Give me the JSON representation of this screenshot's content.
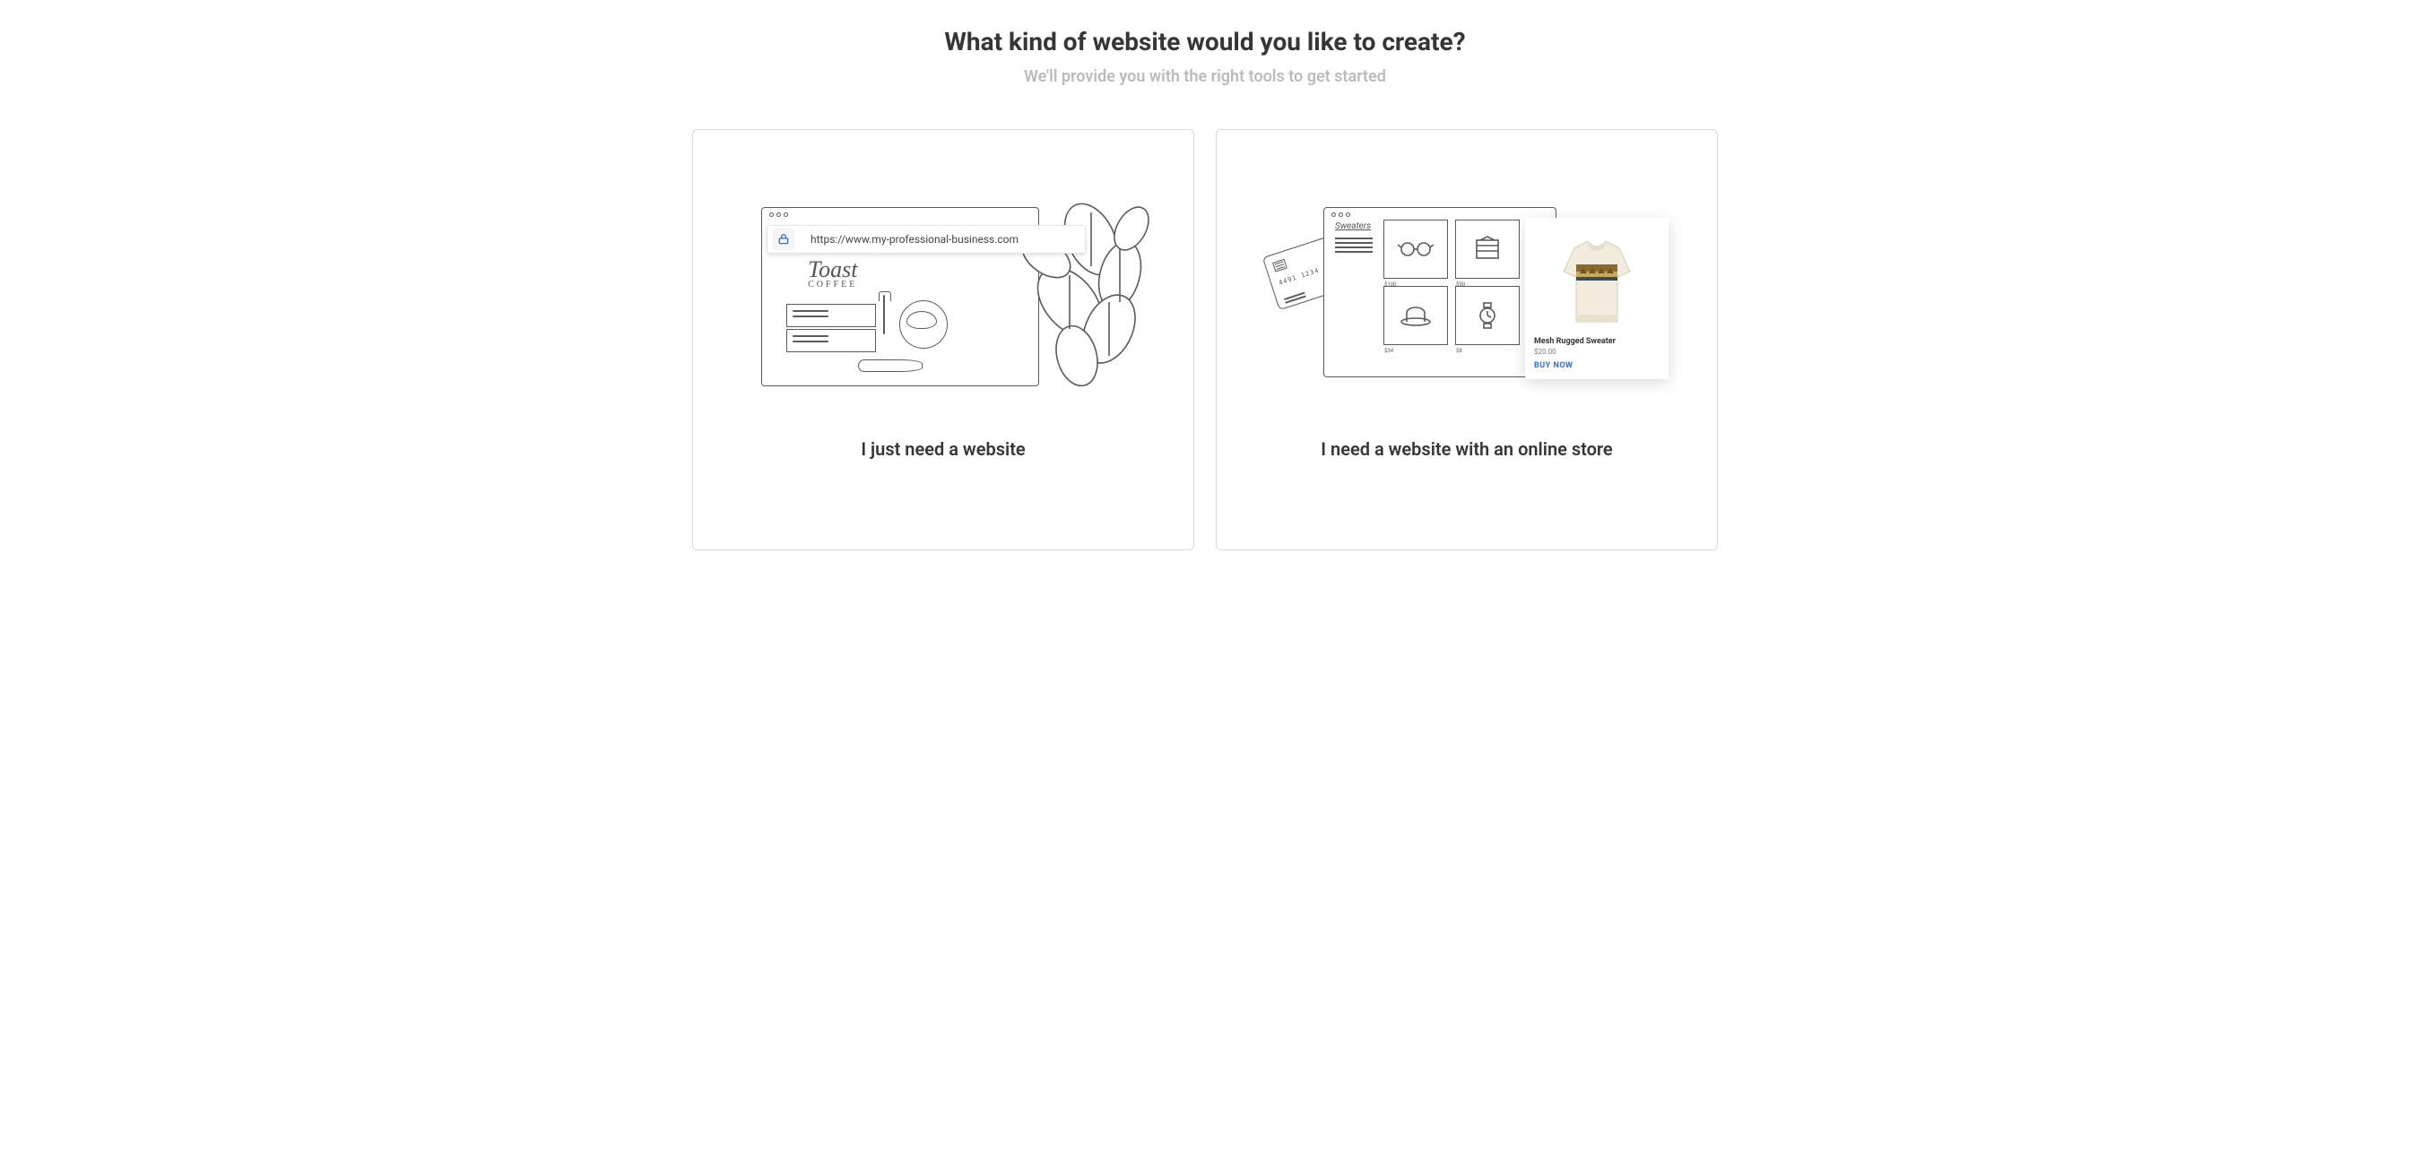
{
  "heading": "What kind of website would you like to create?",
  "subheading": "We'll provide you with the right tools to get started",
  "options": [
    {
      "label": "I just need a website",
      "illustration": {
        "address_url": "https://www.my-professional-business.com",
        "logo_script": "Toast",
        "logo_sub": "COFFEE"
      }
    },
    {
      "label": "I need a website with an online store",
      "illustration": {
        "catalog_title": "Sweaters",
        "cc_number": "4491 1234",
        "tile_prices": [
          "$100",
          "$90",
          "$34",
          "$8"
        ],
        "product_name": "Mesh Rugged Sweater",
        "product_price": "$20.00",
        "buy_label": "BUY NOW"
      }
    }
  ]
}
